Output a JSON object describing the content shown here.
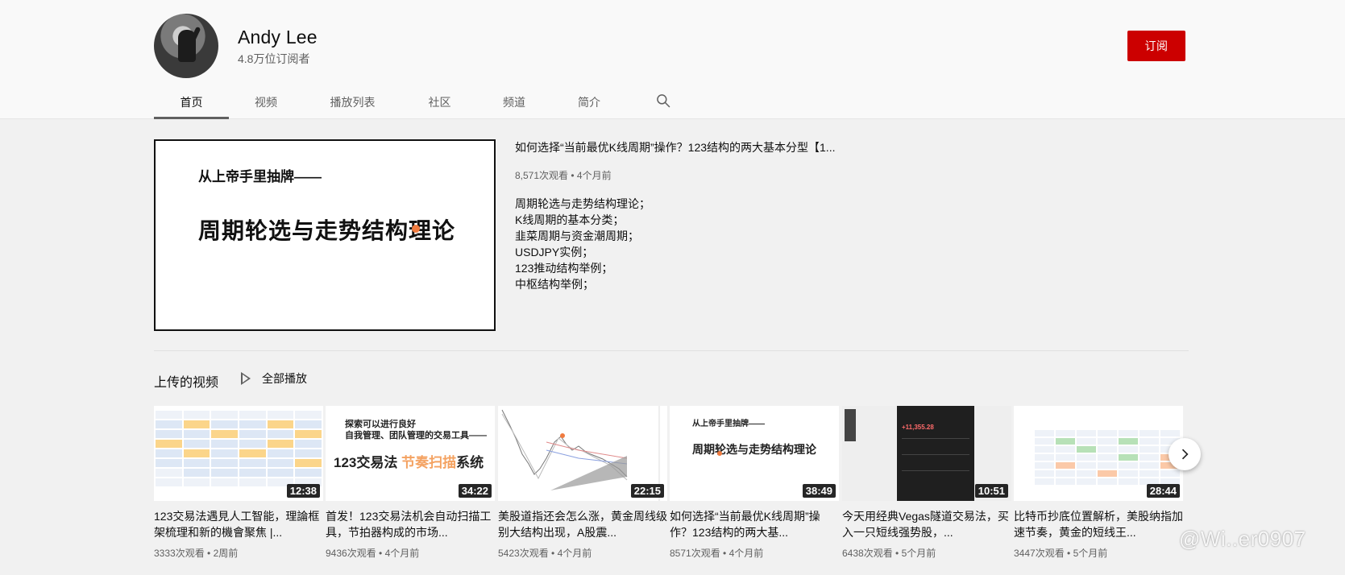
{
  "channel": {
    "name": "Andy Lee",
    "subscribers": "4.8万位订阅者",
    "subscribe_label": "订阅"
  },
  "tabs": [
    {
      "label": "首页",
      "active": true
    },
    {
      "label": "视频",
      "active": false
    },
    {
      "label": "播放列表",
      "active": false
    },
    {
      "label": "社区",
      "active": false
    },
    {
      "label": "频道",
      "active": false
    },
    {
      "label": "简介",
      "active": false
    }
  ],
  "featured": {
    "thumb_line1": "从上帝手里抽牌——",
    "thumb_line2": "周期轮选与走势结构理论",
    "title": "如何选择“当前最优K线周期”操作？123结构的两大基本分型【1...",
    "meta": "8,571次观看 • 4个月前",
    "description": [
      "周期轮选与走势结构理论；",
      "K线周期的基本分类；",
      "韭菜周期与资金潮周期；",
      "USDJPY实例；",
      "123推动结构举例；",
      "中枢结构举例；"
    ]
  },
  "uploads": {
    "section_title": "上传的视频",
    "play_all_label": "全部播放",
    "videos": [
      {
        "duration": "12:38",
        "title": "123交易法遇見人工智能，理論框架梳理和新的機會聚焦 |...",
        "meta": "3333次观看 • 2周前"
      },
      {
        "duration": "34:22",
        "title": "首发！123交易法机会自动扫描工具，节拍器构成的市场...",
        "meta": "9436次观看 • 4个月前",
        "thumb_line1": "探索可以进行良好",
        "thumb_line2": "自我管理、团队管理的交易工具——",
        "thumb_line3a": "123交易法 ",
        "thumb_line3b": "节奏扫描",
        "thumb_line3c": "系统"
      },
      {
        "duration": "22:15",
        "title": "美股道指还会怎么涨，黄金周线级别大结构出现，A股震...",
        "meta": "5423次观看 • 4个月前"
      },
      {
        "duration": "38:49",
        "title": "如何选择“当前最优K线周期”操作？123结构的两大基...",
        "meta": "8571次观看 • 4个月前",
        "thumb_line1": "从上帝手里抽牌——",
        "thumb_line2": "周期轮选与走势结构理论"
      },
      {
        "duration": "10:51",
        "title": "今天用经典Vegas隧道交易法，买入一只短线强势股，...",
        "meta": "6438次观看 • 5个月前",
        "thumb_value": "+11,355.28"
      },
      {
        "duration": "28:44",
        "title": "比特币抄底位置解析，美股纳指加速节奏，黄金的短线王...",
        "meta": "3447次观看 • 5个月前"
      }
    ]
  },
  "watermark": "@Wi..er0907",
  "icons": {
    "search": "search-icon",
    "next": "chevron-right-icon",
    "play": "play-icon"
  }
}
